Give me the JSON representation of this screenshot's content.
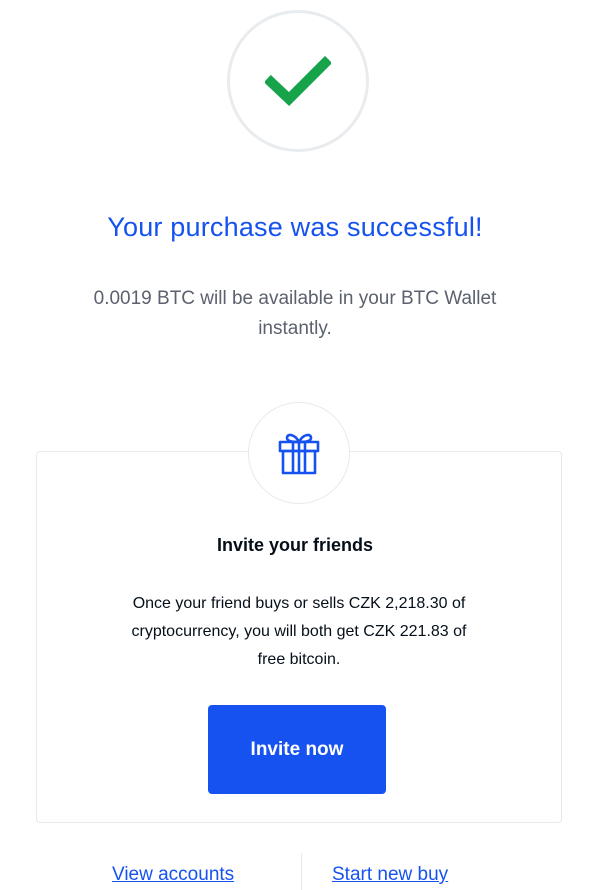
{
  "status": {
    "icon": "checkmark-icon",
    "title": "Your purchase was successful!",
    "message_line1": "0.0019 BTC will be available in your BTC Wallet",
    "message_line2": "instantly.",
    "success_color": "#16a34a",
    "accent_color": "#1652f0"
  },
  "referral": {
    "icon": "gift-icon",
    "title": "Invite your friends",
    "body_line1": "Once your friend buys or sells CZK 2,218.30 of",
    "body_line2": "cryptocurrency, you will both get CZK 221.83 of",
    "body_line3": "free bitcoin.",
    "button_label": "Invite now"
  },
  "footer": {
    "view_accounts": "View accounts",
    "start_new_buy": "Start new buy"
  }
}
